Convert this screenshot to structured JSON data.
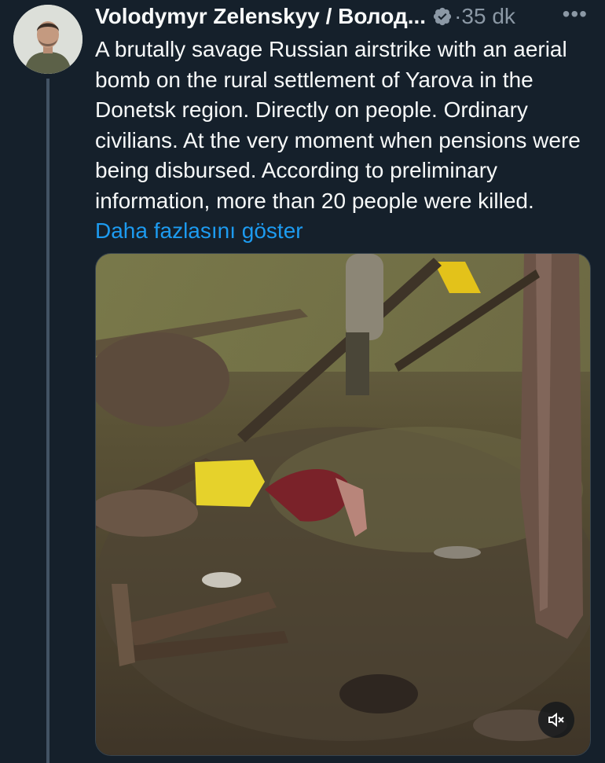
{
  "tweet": {
    "author_name": "Volodymyr Zelenskyy / Волод...",
    "separator": "·",
    "timestamp": "35 dk",
    "more_label": "•••",
    "text": "A brutally savage Russian airstrike with an aerial bomb on the rural settlement of Yarova in the Donetsk region. Directly on people. Ordinary civilians. At the very moment when pensions were being disbursed. According to preliminary information, more than 20 people were killed.",
    "show_more": "Daha fazlasını göster"
  },
  "icons": {
    "verified": "verified-badge-icon",
    "more": "more-options-icon",
    "mute": "muted-speaker-icon"
  },
  "colors": {
    "background": "#15202b",
    "text": "#f7f9f9",
    "secondary_text": "#8b98a5",
    "link": "#1d9bf0",
    "thread_line": "#425364"
  }
}
